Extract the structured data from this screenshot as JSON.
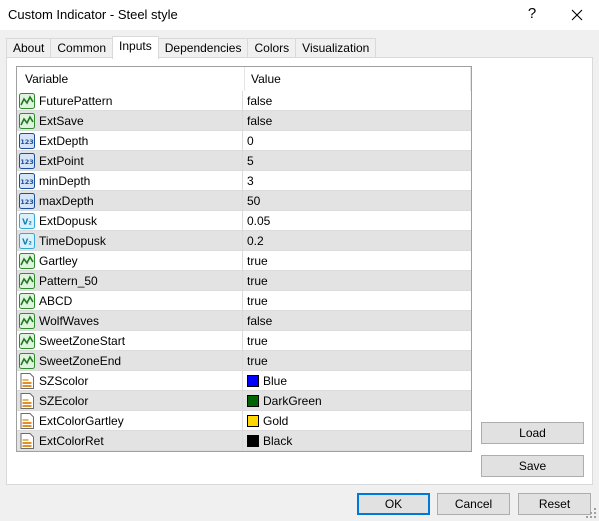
{
  "window": {
    "title": "Custom Indicator - Steel style",
    "help_label": "?"
  },
  "tabs": [
    "About",
    "Common",
    "Inputs",
    "Dependencies",
    "Colors",
    "Visualization"
  ],
  "active_tab": "Inputs",
  "grid": {
    "headers": {
      "variable": "Variable",
      "value": "Value"
    },
    "rows": [
      {
        "name": "FuturePattern",
        "type": "bool",
        "value": "false"
      },
      {
        "name": "ExtSave",
        "type": "bool",
        "value": "false"
      },
      {
        "name": "ExtDepth",
        "type": "int",
        "value": "0"
      },
      {
        "name": "ExtPoint",
        "type": "int",
        "value": "5"
      },
      {
        "name": "minDepth",
        "type": "int",
        "value": "3"
      },
      {
        "name": "maxDepth",
        "type": "int",
        "value": "50"
      },
      {
        "name": "ExtDopusk",
        "type": "double",
        "value": "0.05"
      },
      {
        "name": "TimeDopusk",
        "type": "double",
        "value": "0.2"
      },
      {
        "name": "Gartley",
        "type": "bool",
        "value": "true"
      },
      {
        "name": "Pattern_50",
        "type": "bool",
        "value": "true"
      },
      {
        "name": "ABCD",
        "type": "bool",
        "value": "true"
      },
      {
        "name": "WolfWaves",
        "type": "bool",
        "value": "false"
      },
      {
        "name": "SweetZoneStart",
        "type": "bool",
        "value": "true"
      },
      {
        "name": "SweetZoneEnd",
        "type": "bool",
        "value": "true"
      },
      {
        "name": "SZScolor",
        "type": "color",
        "value": "Blue",
        "color": "#0000ff"
      },
      {
        "name": "SZEcolor",
        "type": "color",
        "value": "DarkGreen",
        "color": "#006400"
      },
      {
        "name": "ExtColorGartley",
        "type": "color",
        "value": "Gold",
        "color": "#ffd700"
      },
      {
        "name": "ExtColorRet",
        "type": "color",
        "value": "Black",
        "color": "#000000"
      }
    ]
  },
  "side_buttons": {
    "load": "Load",
    "save": "Save"
  },
  "footer_buttons": {
    "ok": "OK",
    "cancel": "Cancel",
    "reset": "Reset"
  },
  "colors": {
    "accent": "#0078d7",
    "row_alt": "#e3e3e3",
    "bool_icon_green": "#2e8b2e",
    "int_icon_blue": "#1e4f9c",
    "double_icon_cyan": "#36a7d6"
  }
}
